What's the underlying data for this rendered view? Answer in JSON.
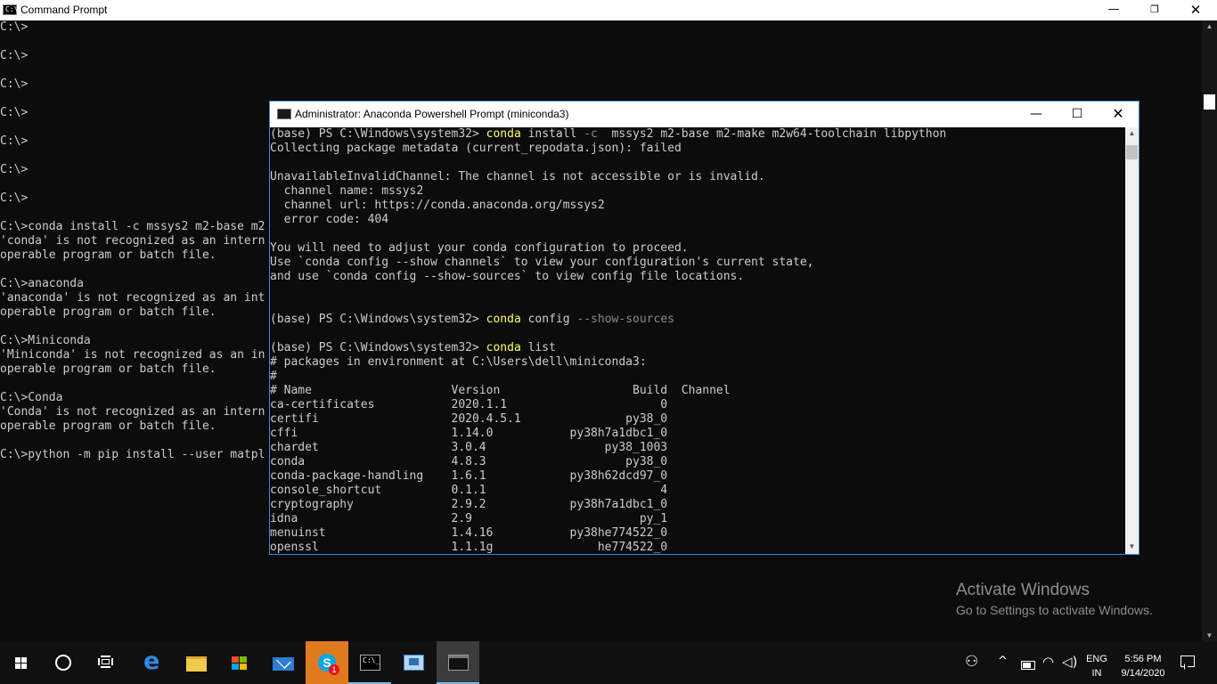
{
  "cmd_window": {
    "title": "Command Prompt",
    "icon_text": "C:\\",
    "controls": {
      "minimize": "—",
      "maximize": "❐",
      "close": "✕"
    },
    "lines": [
      "C:\\>",
      "",
      "C:\\>",
      "",
      "C:\\>",
      "",
      "C:\\>",
      "",
      "C:\\>",
      "",
      "C:\\>",
      "",
      "C:\\>",
      "",
      "C:\\>conda install -c mssys2 m2-base m2",
      "'conda' is not recognized as an intern",
      "operable program or batch file.",
      "",
      "C:\\>anaconda",
      "'anaconda' is not recognized as an int",
      "operable program or batch file.",
      "",
      "C:\\>Miniconda",
      "'Miniconda' is not recognized as an in",
      "operable program or batch file.",
      "",
      "C:\\>Conda",
      "'Conda' is not recognized as an intern",
      "operable program or batch file.",
      "",
      "C:\\>python -m pip install --user matpl"
    ]
  },
  "ps_window": {
    "title": "Administrator: Anaconda Powershell Prompt (miniconda3)",
    "controls": {
      "minimize": "—",
      "maximize": "☐",
      "close": "✕"
    },
    "prompt": "(base) PS C:\\Windows\\system32> ",
    "cmd1": {
      "exe": "conda",
      "rest": " install ",
      "flag": "-c",
      "args": "  mssys2 m2-base m2-make m2w64-toolchain libpython"
    },
    "output1": [
      "Collecting package metadata (current_repodata.json): failed",
      "",
      "UnavailableInvalidChannel: The channel is not accessible or is invalid.",
      "  channel name: mssys2",
      "  channel url: https://conda.anaconda.org/mssys2",
      "  error code: 404",
      "",
      "You will need to adjust your conda configuration to proceed.",
      "Use `conda config --show channels` to view your configuration's current state,",
      "and use `conda config --show-sources` to view config file locations.",
      "",
      ""
    ],
    "cmd2": {
      "exe": "conda",
      "rest": " config ",
      "flag": "--show-sources",
      "args": ""
    },
    "cmd3": {
      "exe": "conda",
      "rest": " list",
      "flag": "",
      "args": ""
    },
    "output3": [
      "# packages in environment at C:\\Users\\dell\\miniconda3:",
      "#",
      "# Name                    Version                   Build  Channel",
      "ca-certificates           2020.1.1                      0",
      "certifi                   2020.4.5.1               py38_0",
      "cffi                      1.14.0           py38h7a1dbc1_0",
      "chardet                   3.0.4                 py38_1003",
      "conda                     4.8.3                    py38_0",
      "conda-package-handling    1.6.1            py38h62dcd97_0",
      "console_shortcut          0.1.1                         4",
      "cryptography              2.9.2            py38h7a1dbc1_0",
      "idna                      2.9                        py_1",
      "menuinst                  1.4.16           py38he774522_0",
      "openssl                   1.1.1g               he774522_0"
    ]
  },
  "watermark": {
    "title": "Activate Windows",
    "subtitle": "Go to Settings to activate Windows."
  },
  "taskbar": {
    "skype_glyph": "S",
    "skype_badge": "1",
    "edge_glyph": "e",
    "cmd_icon_text": "C:\\_",
    "people_glyph": "⚇",
    "chevron_glyph": "^",
    "wifi_glyph": "◠",
    "volume_glyph": "◁)",
    "lang_line1": "ENG",
    "lang_line2": "IN",
    "time": "5:56 PM",
    "date": "9/14/2020"
  },
  "icons": {
    "cmd_app": "cmd-icon",
    "ps_app": "powershell-icon",
    "start": "windows-logo-icon",
    "search": "search-icon",
    "task_view": "task-view-icon",
    "edge": "edge-icon",
    "explorer": "folder-icon",
    "store": "store-icon",
    "mail": "mail-icon",
    "skype": "skype-icon",
    "rdp": "remote-desktop-icon",
    "people": "people-icon",
    "battery": "battery-icon",
    "wifi": "wifi-icon",
    "volume": "volume-icon",
    "action_center": "action-center-icon"
  },
  "colors": {
    "console_bg": "#0c0c0c",
    "console_text": "#cccccc",
    "command_highlight": "#ffff66",
    "param_gray": "#8a8a8a",
    "window_border": "#3d8ad1",
    "skype_bg": "#e07a1f",
    "taskbar_bg": "#101010"
  }
}
